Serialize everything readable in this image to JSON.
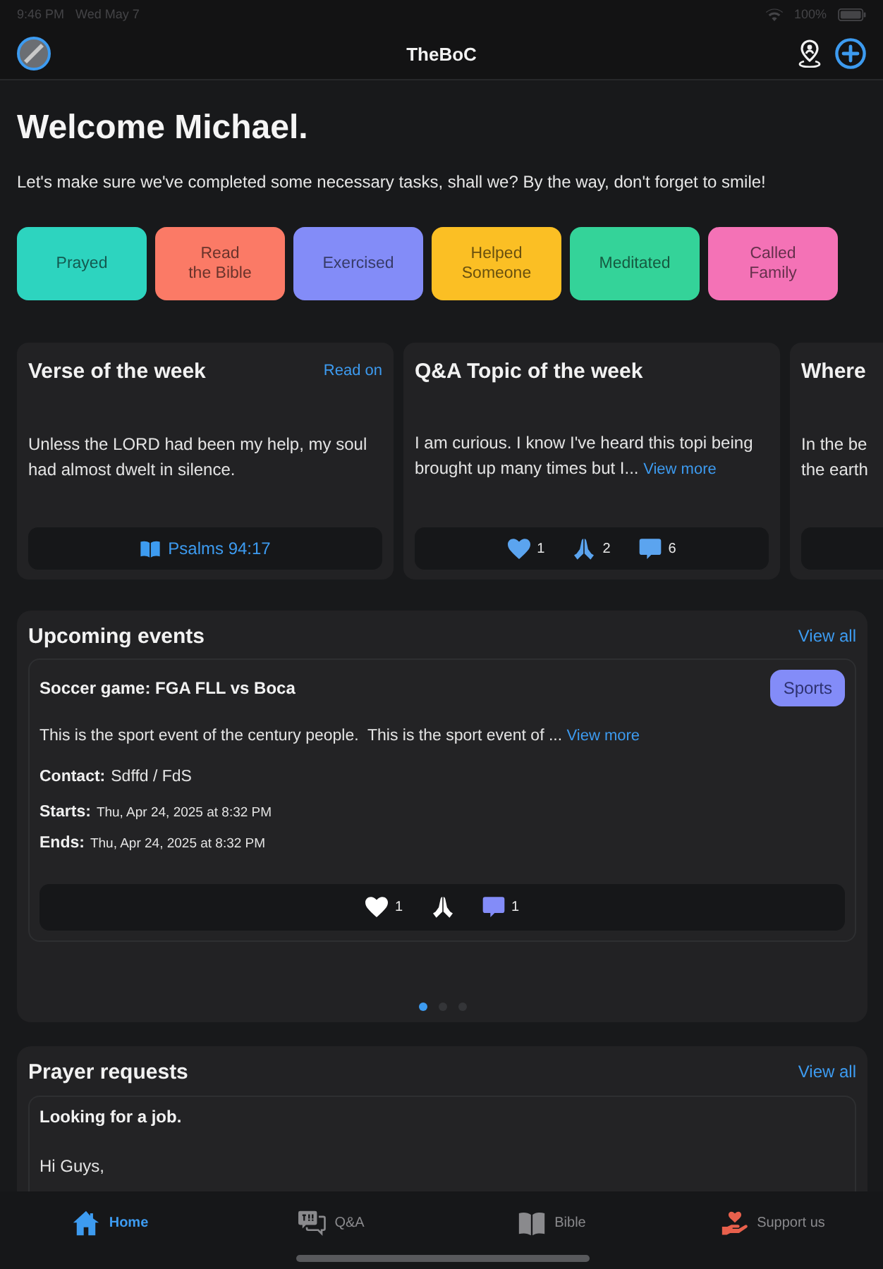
{
  "status_bar": {
    "time": "9:46 PM",
    "date": "Wed May 7",
    "battery": "100%"
  },
  "nav_bar": {
    "title": "TheBoC"
  },
  "welcome": {
    "title": "Welcome Michael.",
    "subtitle": "Let's make sure we've completed some necessary tasks, shall we? By the way, don't forget to smile!"
  },
  "tasks": [
    {
      "label": "Prayed",
      "color": "#2dd4bf"
    },
    {
      "label": "Read\nthe Bible",
      "color": "#fb7a66"
    },
    {
      "label": "Exercised",
      "color": "#838cf8"
    },
    {
      "label": "Helped\nSomeone",
      "color": "#fbbf24"
    },
    {
      "label": "Meditated",
      "color": "#34d399"
    },
    {
      "label": "Called\nFamily",
      "color": "#f472b6"
    }
  ],
  "highlight_cards": [
    {
      "kind": "verse",
      "title": "Verse of the week",
      "link": "Read on",
      "body": "Unless the LORD had been my help, my soul had almost dwelt in silence.",
      "reference": "Psalms 94:17"
    },
    {
      "kind": "topic",
      "title": "Q&A Topic of the week",
      "body": "I am curious. I know I've heard this topi being brought up many times but I...",
      "link": "View more",
      "reactions": [
        {
          "kind": "heart",
          "count": "1",
          "color": "#5ba4ef"
        },
        {
          "kind": "pray",
          "count": "2",
          "color": "#5ba4ef"
        },
        {
          "kind": "comment",
          "count": "6",
          "color": "#5ba4ef"
        }
      ]
    },
    {
      "kind": "partial",
      "title": "Where",
      "body": "In the be\nthe earth"
    }
  ],
  "upcoming_events": {
    "title": "Upcoming events",
    "link": "View all",
    "events": [
      {
        "title": "Soccer game: FGA FLL vs Boca",
        "tag": "Sports",
        "description": "This is the sport event of the century people.  This is the sport event of ...",
        "link": "View more",
        "contact_label": "Contact:",
        "contact": "Sdffd / FdS",
        "starts_label": "Starts:",
        "starts": "Thu, Apr 24, 2025 at 8:32 PM",
        "ends_label": "Ends:",
        "ends": "Thu, Apr 24, 2025 at 8:32 PM",
        "reactions": [
          {
            "kind": "heart",
            "count": "1",
            "color": "#ffffff"
          },
          {
            "kind": "pray",
            "color": "#ffffff"
          },
          {
            "kind": "comment",
            "count": "1",
            "color": "#838cf8"
          }
        ]
      }
    ],
    "pages": [
      {
        "selected": true
      },
      {
        "selected": false
      },
      {
        "selected": false
      }
    ]
  },
  "prayer_requests": {
    "title": "Prayer requests",
    "link": "View all",
    "requests": [
      {
        "title": "Looking for a job.",
        "body": "Hi Guys,"
      }
    ]
  },
  "tab_bar": [
    {
      "kind": "home",
      "label": "Home",
      "selected": true
    },
    {
      "kind": "qa",
      "label": "Q&A",
      "selected": false
    },
    {
      "kind": "bible",
      "label": "Bible",
      "selected": false
    },
    {
      "kind": "support",
      "label": "Support us",
      "selected": false
    }
  ]
}
